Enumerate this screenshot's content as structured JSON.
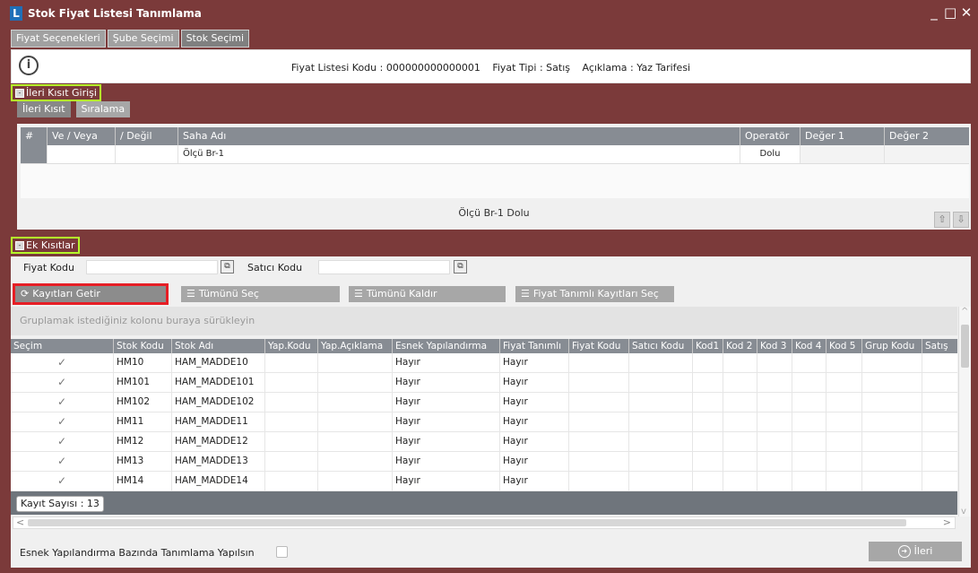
{
  "window": {
    "title": "Stok Fiyat Listesi Tanımlama",
    "logo_letter": "L",
    "controls": [
      "_",
      "□",
      "✕"
    ]
  },
  "tabs": [
    {
      "label": "Fiyat Seçenekleri"
    },
    {
      "label": "Şube Seçimi"
    },
    {
      "label": "Stok Seçimi"
    }
  ],
  "info": {
    "icon": "info-icon",
    "kodu_label": "Fiyat Listesi Kodu :",
    "kodu_value": "000000000000001",
    "tipi_label": "Fiyat Tipi :",
    "tipi_value": "Satış",
    "aciklama_label": "Açıklama :",
    "aciklama_value": "Yaz Tarifesi"
  },
  "ileri_kisit": {
    "section_label": "İleri Kısıt Girişi",
    "subtabs": [
      {
        "label": "İleri Kısıt"
      },
      {
        "label": "Sıralama"
      }
    ],
    "columns": [
      "#",
      "Ve / Veya",
      "/ Değil",
      "Saha Adı",
      "Operatör",
      "Değer 1",
      "Değer 2"
    ],
    "rows": [
      {
        "hash": "",
        "ve_veya": "",
        "degil": "",
        "saha_adi": "Ölçü Br-1",
        "operator": "Dolu",
        "deger1": "",
        "deger2": ""
      }
    ],
    "summary": "Ölçü Br-1 Dolu"
  },
  "ek_kisitlar": {
    "section_label": "Ek Kısıtlar",
    "fiyat_kodu_label": "Fiyat Kodu",
    "fiyat_kodu_value": "",
    "satici_kodu_label": "Satıcı Kodu",
    "satici_kodu_value": ""
  },
  "toolbar": {
    "getir_label": "Kayıtları Getir",
    "tumunu_sec_label": "Tümünü Seç",
    "tumunu_kaldir_label": "Tümünü Kaldır",
    "fiyat_tanimli_label": "Fiyat Tanımlı Kayıtları Seç"
  },
  "grid": {
    "group_hint": "Gruplamak istediğiniz kolonu buraya sürükleyin",
    "columns": [
      "Seçim",
      "Stok Kodu",
      "Stok Adı",
      "Yap.Kodu",
      "Yap.Açıklama",
      "Esnek Yapılandırma",
      "Fiyat Tanımlı",
      "Fiyat Kodu",
      "Satıcı Kodu",
      "Kod1",
      "Kod 2",
      "Kod 3",
      "Kod 4",
      "Kod 5",
      "Grup Kodu",
      "Satış"
    ],
    "rows": [
      {
        "secim": "✓",
        "stok_kodu": "HM10",
        "stok_adi": "HAM_MADDE10",
        "esnek": "Hayır",
        "fiyat_tanimli": "Hayır"
      },
      {
        "secim": "✓",
        "stok_kodu": "HM101",
        "stok_adi": "HAM_MADDE101",
        "esnek": "Hayır",
        "fiyat_tanimli": "Hayır"
      },
      {
        "secim": "✓",
        "stok_kodu": "HM102",
        "stok_adi": "HAM_MADDE102",
        "esnek": "Hayır",
        "fiyat_tanimli": "Hayır"
      },
      {
        "secim": "✓",
        "stok_kodu": "HM11",
        "stok_adi": "HAM_MADDE11",
        "esnek": "Hayır",
        "fiyat_tanimli": "Hayır"
      },
      {
        "secim": "✓",
        "stok_kodu": "HM12",
        "stok_adi": "HAM_MADDE12",
        "esnek": "Hayır",
        "fiyat_tanimli": "Hayır"
      },
      {
        "secim": "✓",
        "stok_kodu": "HM13",
        "stok_adi": "HAM_MADDE13",
        "esnek": "Hayır",
        "fiyat_tanimli": "Hayır"
      },
      {
        "secim": "✓",
        "stok_kodu": "HM14",
        "stok_adi": "HAM_MADDE14",
        "esnek": "Hayır",
        "fiyat_tanimli": "Hayır"
      }
    ],
    "record_count": "Kayıt Sayısı : 13"
  },
  "footer": {
    "esnek_label": "Esnek Yapılandırma Bazında Tanımlama Yapılsın",
    "ileri_label": "İleri"
  },
  "colors": {
    "frame": "#7b3a3a",
    "section_highlight": "#b6ff2a",
    "button_highlight": "#e61e25",
    "grid_header": "#878c93"
  }
}
